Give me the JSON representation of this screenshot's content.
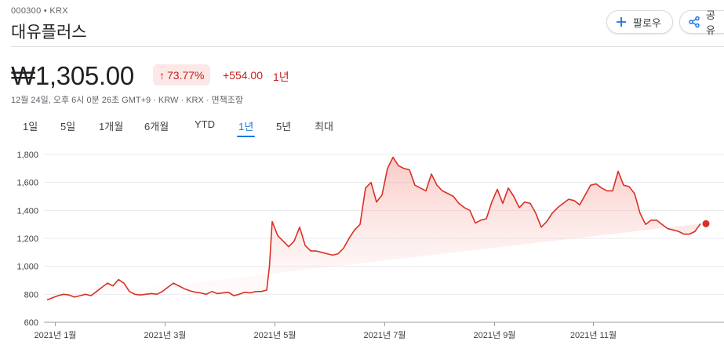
{
  "header": {
    "ticker": "000300 • KRX",
    "name": "대유플러스",
    "follow_label": "팔로우",
    "share_label": "공유"
  },
  "quote": {
    "price": "₩1,305.00",
    "change_pct": "73.77%",
    "change_abs": "+554.00",
    "period": "1년",
    "meta": "12월 24일, 오후 6시 0분 26초 GMT+9 · KRW · KRX · 면책조항",
    "change_color": "#c5221f"
  },
  "tabs": [
    {
      "label": "1일",
      "active": false
    },
    {
      "label": "5일",
      "active": false
    },
    {
      "label": "1개월",
      "active": false
    },
    {
      "label": "6개월",
      "active": false
    },
    {
      "label": "YTD",
      "active": false
    },
    {
      "label": "1년",
      "active": true
    },
    {
      "label": "5년",
      "active": false
    },
    {
      "label": "최대",
      "active": false
    }
  ],
  "chart_data": {
    "type": "area",
    "line_color": "#d93025",
    "ylim": [
      600,
      1800
    ],
    "yticks": [
      600,
      800,
      1000,
      1200,
      1400,
      1600,
      1800
    ],
    "ytick_labels": [
      "600",
      "800",
      "1,000",
      "1,200",
      "1,400",
      "1,600",
      "1,800"
    ],
    "xlim": [
      0,
      12
    ],
    "xticks": [
      {
        "label": "2021년 1월",
        "at": 0.15
      },
      {
        "label": "2021년 3월",
        "at": 2.15
      },
      {
        "label": "2021년 5월",
        "at": 4.15
      },
      {
        "label": "2021년 7월",
        "at": 6.15
      },
      {
        "label": "2021년 9월",
        "at": 8.15
      },
      {
        "label": "2021년 11월",
        "at": 9.95
      }
    ],
    "x": [
      0.0,
      0.1,
      0.2,
      0.3,
      0.4,
      0.5,
      0.6,
      0.7,
      0.8,
      0.9,
      1.0,
      1.1,
      1.2,
      1.3,
      1.4,
      1.5,
      1.6,
      1.7,
      1.8,
      1.9,
      2.0,
      2.1,
      2.2,
      2.3,
      2.4,
      2.5,
      2.6,
      2.7,
      2.8,
      2.9,
      3.0,
      3.1,
      3.2,
      3.3,
      3.4,
      3.5,
      3.6,
      3.7,
      3.8,
      3.9,
      4.0,
      4.05,
      4.1,
      4.2,
      4.3,
      4.4,
      4.5,
      4.6,
      4.7,
      4.8,
      4.9,
      5.0,
      5.1,
      5.2,
      5.3,
      5.4,
      5.5,
      5.6,
      5.7,
      5.8,
      5.9,
      6.0,
      6.1,
      6.2,
      6.3,
      6.4,
      6.5,
      6.6,
      6.7,
      6.8,
      6.9,
      7.0,
      7.1,
      7.2,
      7.3,
      7.4,
      7.5,
      7.6,
      7.7,
      7.8,
      7.9,
      8.0,
      8.1,
      8.2,
      8.3,
      8.4,
      8.5,
      8.6,
      8.7,
      8.8,
      8.9,
      9.0,
      9.1,
      9.2,
      9.3,
      9.4,
      9.5,
      9.6,
      9.7,
      9.8,
      9.9,
      10.0,
      10.1,
      10.2,
      10.3,
      10.4,
      10.5,
      10.6,
      10.7,
      10.8,
      10.9,
      11.0,
      11.1,
      11.2,
      11.3,
      11.4,
      11.5,
      11.6,
      11.7,
      11.8,
      11.9,
      12.0
    ],
    "y": [
      760,
      775,
      790,
      800,
      795,
      780,
      790,
      800,
      790,
      820,
      850,
      880,
      860,
      905,
      880,
      820,
      800,
      795,
      800,
      805,
      800,
      820,
      850,
      880,
      860,
      840,
      825,
      815,
      810,
      800,
      820,
      805,
      810,
      815,
      790,
      800,
      815,
      810,
      820,
      820,
      830,
      1000,
      1320,
      1220,
      1180,
      1140,
      1180,
      1280,
      1150,
      1110,
      1110,
      1100,
      1090,
      1080,
      1090,
      1130,
      1200,
      1260,
      1300,
      1560,
      1600,
      1460,
      1510,
      1700,
      1780,
      1720,
      1700,
      1690,
      1580,
      1560,
      1540,
      1660,
      1580,
      1540,
      1520,
      1500,
      1450,
      1420,
      1400,
      1310,
      1330,
      1340,
      1460,
      1550,
      1450,
      1560,
      1500,
      1420,
      1460,
      1450,
      1380,
      1280,
      1320,
      1380,
      1420,
      1450,
      1480,
      1470,
      1440,
      1510,
      1580,
      1590,
      1560,
      1540,
      1540,
      1680,
      1580,
      1570,
      1520,
      1380,
      1300,
      1330,
      1330,
      1300,
      1270,
      1260,
      1250,
      1230,
      1230,
      1250,
      1305
    ],
    "last_point": {
      "x": 12.0,
      "y": 1305
    }
  }
}
